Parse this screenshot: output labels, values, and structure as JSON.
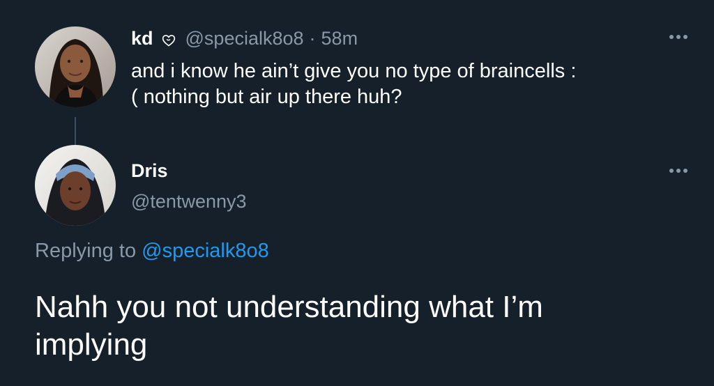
{
  "parent_tweet": {
    "display_name": "kd",
    "badge_icon": "heart-outline-icon",
    "handle": "@specialk8o8",
    "separator": "·",
    "time": "58m",
    "text": "and i know he ain’t give you no type of braincells :\n( nothing but air up there huh?"
  },
  "reply_tweet": {
    "display_name": "Dris",
    "handle": "@tentwenny3",
    "replying_prefix": "Replying to",
    "replying_mention": "@specialk8o8",
    "text": "Nahh you not understanding what I’m implying"
  },
  "colors": {
    "background": "#15202b",
    "text_primary": "#ffffff",
    "text_secondary": "#8b98a5",
    "accent": "#1d9bf0"
  }
}
